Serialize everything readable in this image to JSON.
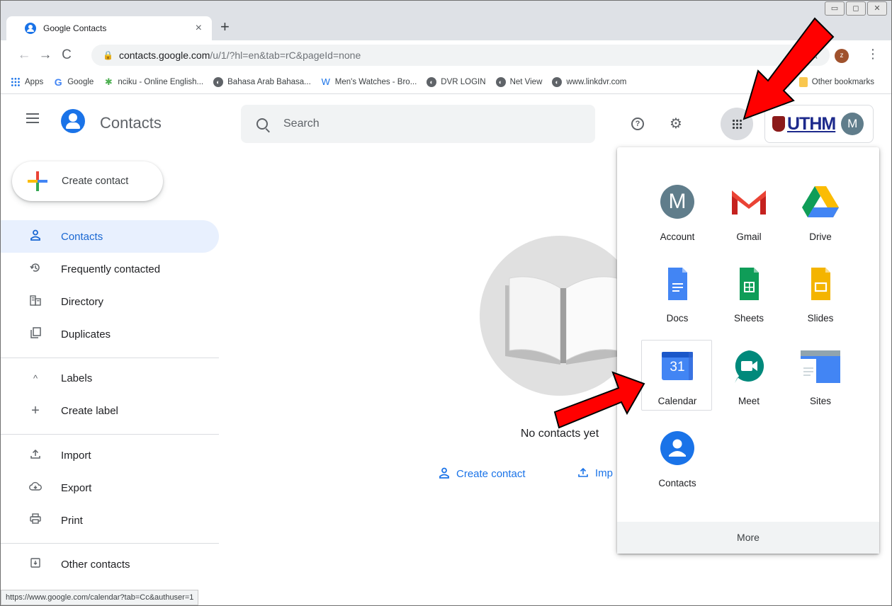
{
  "browser": {
    "tab_title": "Google Contacts",
    "tab_close": "×",
    "new_tab": "+",
    "window_controls": [
      "▭",
      "◻",
      "✕"
    ],
    "back": "←",
    "forward": "→",
    "reload": "C",
    "url_host": "contacts.google.com",
    "url_path": "/u/1/?hl=en&tab=rC&pageId=none",
    "profile_initial": "z",
    "menu": "⋮",
    "star": "☆",
    "bookmarks": [
      {
        "label": "Apps",
        "icon": "apps-grid-icon"
      },
      {
        "label": "Google",
        "icon": "google-g-icon"
      },
      {
        "label": "nciku - Online English...",
        "icon": "nciku-icon"
      },
      {
        "label": "Bahasa Arab Bahasa...",
        "icon": "globe-icon"
      },
      {
        "label": "Men's Watches - Bro...",
        "icon": "w-icon"
      },
      {
        "label": "DVR LOGIN",
        "icon": "globe-icon"
      },
      {
        "label": "Net View",
        "icon": "globe-icon"
      },
      {
        "label": "www.linkdvr.com",
        "icon": "globe-icon"
      }
    ],
    "other_bookmarks": "Other bookmarks",
    "status_url": "https://www.google.com/calendar?tab=Cc&authuser=1"
  },
  "header": {
    "title": "Contacts",
    "search_placeholder": "Search",
    "help": "?",
    "settings": "⚙",
    "org_logo": "UTHM",
    "account_initial": "M"
  },
  "sidebar": {
    "create_label": "Create contact",
    "items": [
      {
        "label": "Contacts",
        "icon": "person-icon",
        "active": true
      },
      {
        "label": "Frequently contacted",
        "icon": "history-icon"
      },
      {
        "label": "Directory",
        "icon": "building-icon"
      },
      {
        "label": "Duplicates",
        "icon": "copy-icon"
      }
    ],
    "labels_header": "Labels",
    "create_label_item": "Create label",
    "tools": [
      {
        "label": "Import",
        "icon": "upload-icon"
      },
      {
        "label": "Export",
        "icon": "cloud-download-icon"
      },
      {
        "label": "Print",
        "icon": "printer-icon"
      }
    ],
    "other_contacts": "Other contacts"
  },
  "main": {
    "empty_message": "No contacts yet",
    "create_link": "Create contact",
    "import_link": "Imp"
  },
  "launcher": {
    "apps": [
      {
        "name": "Account",
        "icon": "account-icon",
        "initial": "M"
      },
      {
        "name": "Gmail",
        "icon": "gmail-icon"
      },
      {
        "name": "Drive",
        "icon": "drive-icon"
      },
      {
        "name": "Docs",
        "icon": "docs-icon"
      },
      {
        "name": "Sheets",
        "icon": "sheets-icon"
      },
      {
        "name": "Slides",
        "icon": "slides-icon"
      },
      {
        "name": "Calendar",
        "icon": "calendar-icon",
        "day": "31"
      },
      {
        "name": "Meet",
        "icon": "meet-icon"
      },
      {
        "name": "Sites",
        "icon": "sites-icon"
      },
      {
        "name": "Contacts",
        "icon": "contacts-icon"
      }
    ],
    "more": "More"
  },
  "colors": {
    "accent": "#1a73e8",
    "active_bg": "#e8f0fe",
    "arrow": "#ff0000"
  }
}
